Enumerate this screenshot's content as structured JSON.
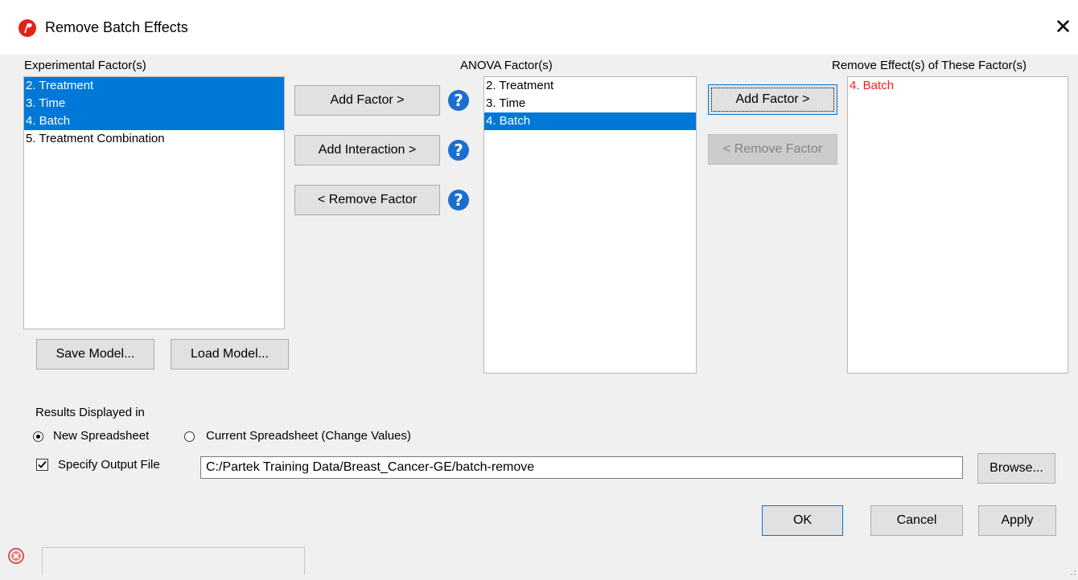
{
  "window": {
    "title": "Remove Batch Effects",
    "close_glyph": "✕"
  },
  "experimental": {
    "label": "Experimental Factor(s)",
    "items": [
      {
        "text": "2. Treatment",
        "selected": true
      },
      {
        "text": "3. Time",
        "selected": true
      },
      {
        "text": "4. Batch",
        "selected": true
      },
      {
        "text": "5. Treatment Combination",
        "selected": false
      }
    ],
    "save_label": "Save Model...",
    "load_label": "Load Model..."
  },
  "middle_buttons": {
    "add_factor": "Add Factor >",
    "add_interaction": "Add Interaction >",
    "remove_factor": "< Remove Factor",
    "help_glyph": "?"
  },
  "anova": {
    "label": "ANOVA Factor(s)",
    "items": [
      {
        "text": "2. Treatment",
        "selected": false
      },
      {
        "text": "3. Time",
        "selected": false
      },
      {
        "text": "4. Batch",
        "selected": true
      }
    ]
  },
  "right_buttons": {
    "add_factor": "Add Factor >",
    "remove_factor": "< Remove Factor"
  },
  "remove_effects": {
    "label": "Remove Effect(s) of These Factor(s)",
    "items": [
      {
        "text": "4. Batch",
        "color": "#ff1a1a"
      }
    ]
  },
  "results": {
    "label": "Results Displayed in",
    "new_spreadsheet": "New Spreadsheet",
    "current_spreadsheet": "Current Spreadsheet (Change Values)",
    "selected": "new"
  },
  "output": {
    "checkbox_label": "Specify Output File",
    "checked": true,
    "path": "C:/Partek Training Data/Breast_Cancer-GE/batch-remove",
    "browse_label": "Browse..."
  },
  "footer": {
    "ok": "OK",
    "cancel": "Cancel",
    "apply": "Apply"
  },
  "colors": {
    "selection": "#0078d7",
    "accent_red": "#e2231a",
    "help_blue": "#1a6ed0"
  },
  "icons": [
    "partek-app-icon",
    "close-icon",
    "help-icon",
    "error-status-icon",
    "resize-grip-icon"
  ]
}
